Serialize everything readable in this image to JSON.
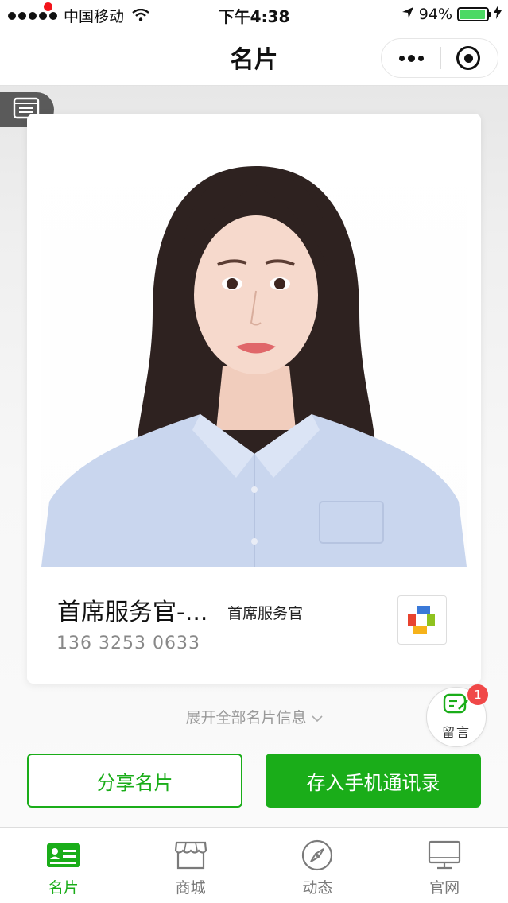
{
  "status_bar": {
    "carrier": "中国移动",
    "time": "下午4:38",
    "battery": "94%",
    "battery_level": 0.94
  },
  "nav": {
    "title": "名片"
  },
  "card": {
    "name": "首席服务官-...",
    "title": "首席服务官",
    "phone": "136 3253 0633"
  },
  "expand_label": "展开全部名片信息",
  "message": {
    "label": "留言",
    "badge": "1"
  },
  "actions": {
    "share_label": "分享名片",
    "save_label": "存入手机通讯录"
  },
  "tabs": [
    {
      "label": "名片",
      "icon": "card-icon",
      "active": true
    },
    {
      "label": "商城",
      "icon": "store-icon",
      "active": false
    },
    {
      "label": "动态",
      "icon": "compass-icon",
      "active": false
    },
    {
      "label": "官网",
      "icon": "monitor-icon",
      "active": false
    }
  ],
  "colors": {
    "accent": "#1aad19",
    "badge": "#f04848",
    "battery": "#4cd964"
  }
}
